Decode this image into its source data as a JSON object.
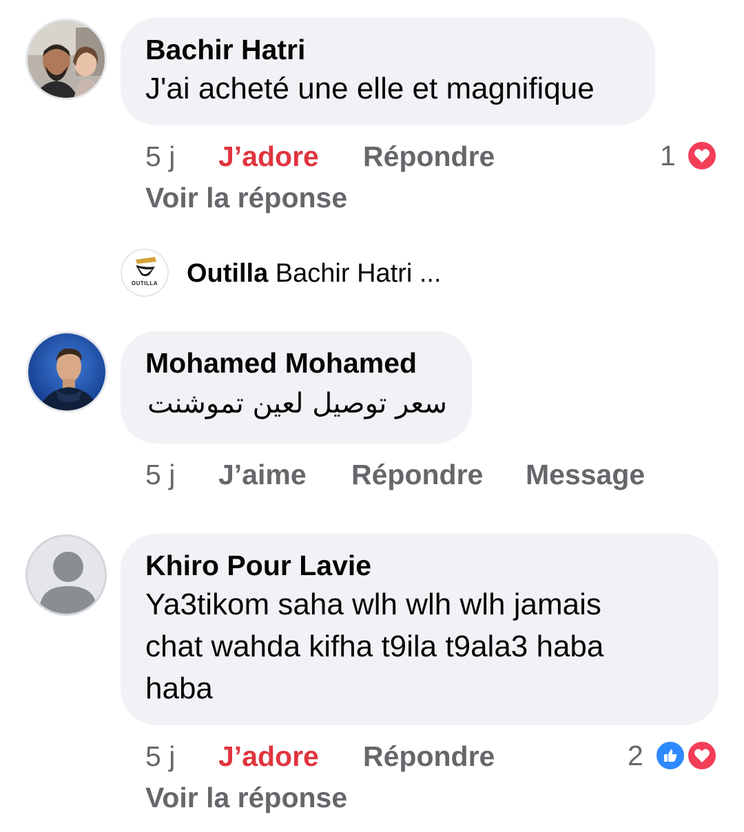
{
  "comments": [
    {
      "author": "Bachir Hatri",
      "text": "J'ai acheté une elle et magnifique",
      "time": "5 j",
      "like_label": "J’adore",
      "reply_label": "Répondre",
      "reaction_count": "1",
      "reactions": [
        "love-icon"
      ],
      "view_reply_label": "Voir la réponse"
    },
    {
      "author": "Mohamed Mohamed",
      "text": "سعر توصيل لعين تموشنت",
      "time": "5 j",
      "like_label": "J’aime",
      "reply_label": "Répondre",
      "message_label": "Message"
    },
    {
      "author": "Khiro Pour Lavie",
      "text_lines": [
        "Ya3tikom saha wlh wlh wlh jamais",
        "chat wahda kifha t9ila  t9ala3 haba",
        "haba"
      ],
      "time": "5 j",
      "like_label": "J’adore",
      "reply_label": "Répondre",
      "reaction_count": "2",
      "reactions": [
        "like-icon",
        "love-icon"
      ],
      "view_reply_label": "Voir la réponse"
    }
  ],
  "reply_preview": {
    "author": "Outilla",
    "text": "Bachir Hatri ...",
    "logo_text": "OUTILLA"
  },
  "colors": {
    "bubble": "#f0f2f5",
    "secondary_text": "#65676b",
    "love_red": "#e0353f",
    "like_blue": "#2e89ff"
  }
}
